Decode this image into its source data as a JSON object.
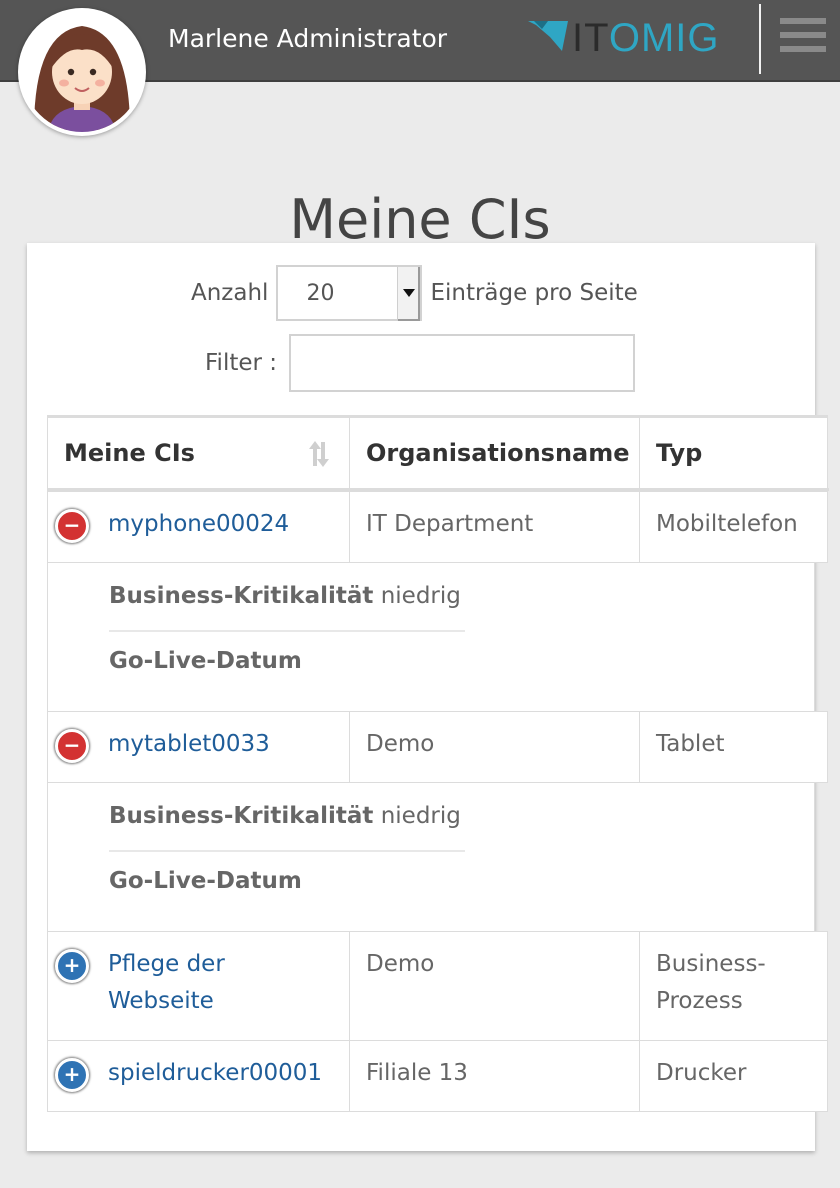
{
  "header": {
    "username": "Marlene Administrator",
    "logo": {
      "part1": "IT",
      "part2": "OMIG"
    },
    "menu_icon": "hamburger-menu-icon"
  },
  "page_title": "Meine CIs",
  "controls": {
    "length_label": "Anzahl",
    "length_value": "20",
    "length_suffix": "Einträge pro Seite",
    "filter_label": "Filter :",
    "filter_value": ""
  },
  "table": {
    "columns": [
      "Meine CIs",
      "Organisationsname",
      "Typ"
    ],
    "rows": [
      {
        "name": "myphone00024",
        "org": "IT Department",
        "type": "Mobiltelefon",
        "expanded": true,
        "details": {
          "crit_label": "Business-Kritikalität",
          "crit_value": "niedrig",
          "golive_label": "Go-Live-Datum"
        }
      },
      {
        "name": "mytablet0033",
        "org": "Demo",
        "type": "Tablet",
        "expanded": true,
        "details": {
          "crit_label": "Business-Kritikalität",
          "crit_value": "niedrig",
          "golive_label": "Go-Live-Datum"
        }
      },
      {
        "name": "Pflege der Webseite",
        "org": "Demo",
        "type": "Business-Prozess",
        "expanded": false
      },
      {
        "name": "spieldrucker00001",
        "org": "Filiale 13",
        "type": "Drucker",
        "expanded": false
      }
    ]
  },
  "colors": {
    "header_bg": "#555555",
    "link": "#1f5d99",
    "collapse": "#d33232",
    "expand": "#2f73b4",
    "logo_accent": "#2fa6c4"
  }
}
